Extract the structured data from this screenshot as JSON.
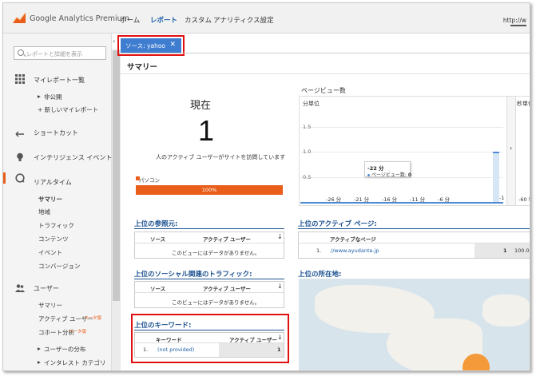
{
  "app": {
    "brand": "Google Analytics Premium",
    "url": "http://w"
  },
  "nav": {
    "home": "ホーム",
    "report": "レポート",
    "custom": "カスタム",
    "admin": "アナリティクス設定"
  },
  "sidebar": {
    "search_placeholder": "レポートと詳細を表示",
    "my_reports": "マイレポート一覧",
    "private": "非公開",
    "new_report": "+ 新しいマイレポート",
    "shortcut": "ショートカット",
    "intelligence": "インテリジェンス イベント",
    "realtime": "リアルタイム",
    "realtime_items": [
      "サマリー",
      "地域",
      "トラフィック",
      "コンテンツ",
      "イベント",
      "コンバージョン"
    ],
    "users": "ユーザー",
    "user_items": [
      "サマリー",
      "アクティブ ユーザー",
      "コホート分析",
      "ユーザーの分布",
      "インタレスト カテゴリ"
    ],
    "beta": "ベータ版",
    "collapse_icon": "‹"
  },
  "segment": {
    "label": "ソース: yahoo",
    "close": "✕"
  },
  "page": {
    "title": "サマリー"
  },
  "now": {
    "label": "現在",
    "count": "1",
    "description": "人のアクティブ ユーザーがサイトを訪問しています",
    "device": "パソコン",
    "device_pct": "100%",
    "device_fraction": 1.0
  },
  "pageviews": {
    "title": "ページビュー数",
    "unit_min": "分単位",
    "unit_sec": "秒単位",
    "tooltip_time": "-22 分",
    "tooltip_label": "ページビュー数:",
    "tooltip_value": "0",
    "right_tick": "-60 秒"
  },
  "chart_data": {
    "type": "bar",
    "title": "ページビュー数",
    "ylim": [
      0,
      1.5
    ],
    "yticks": [
      "1.5",
      "1.0",
      "0.5"
    ],
    "xticks": [
      "-26 分",
      "-21 分",
      "-16 分",
      "-11 分",
      "-6 分",
      "-1"
    ],
    "values": [
      {
        "x": "-1",
        "y": 1
      }
    ]
  },
  "referrals": {
    "title": "上位の参照元:",
    "col_source": "ソース",
    "col_active": "アクティブ ユーザー",
    "empty": "このビューにはデータがありません。"
  },
  "active_pages": {
    "title": "上位のアクティブ ページ:",
    "col_page": "アクティブなページ",
    "rows": [
      {
        "idx": "1.",
        "page": "//www.ayudante.jp",
        "count": "1",
        "pct": "100.0"
      }
    ]
  },
  "social": {
    "title": "上位のソーシャル関連のトラフィック:",
    "col_source": "ソース",
    "col_active": "アクティブ ユーザー",
    "empty": "このビューにはデータがありません。"
  },
  "locations": {
    "title": "上位の所在地:"
  },
  "keywords": {
    "title": "上位のキーワード:",
    "col_keyword": "キーワード",
    "col_active": "アクティブ ユーザー",
    "rows": [
      {
        "idx": "1.",
        "keyword": "(not provided)",
        "count": "1"
      }
    ]
  },
  "sort_icon": "↓",
  "chevron": "›",
  "bullet": "▸",
  "colors": {
    "accent": "#e95e1a",
    "link": "#1a5ea8",
    "segment": "#3f7dd0",
    "highlight": "#e01010"
  }
}
